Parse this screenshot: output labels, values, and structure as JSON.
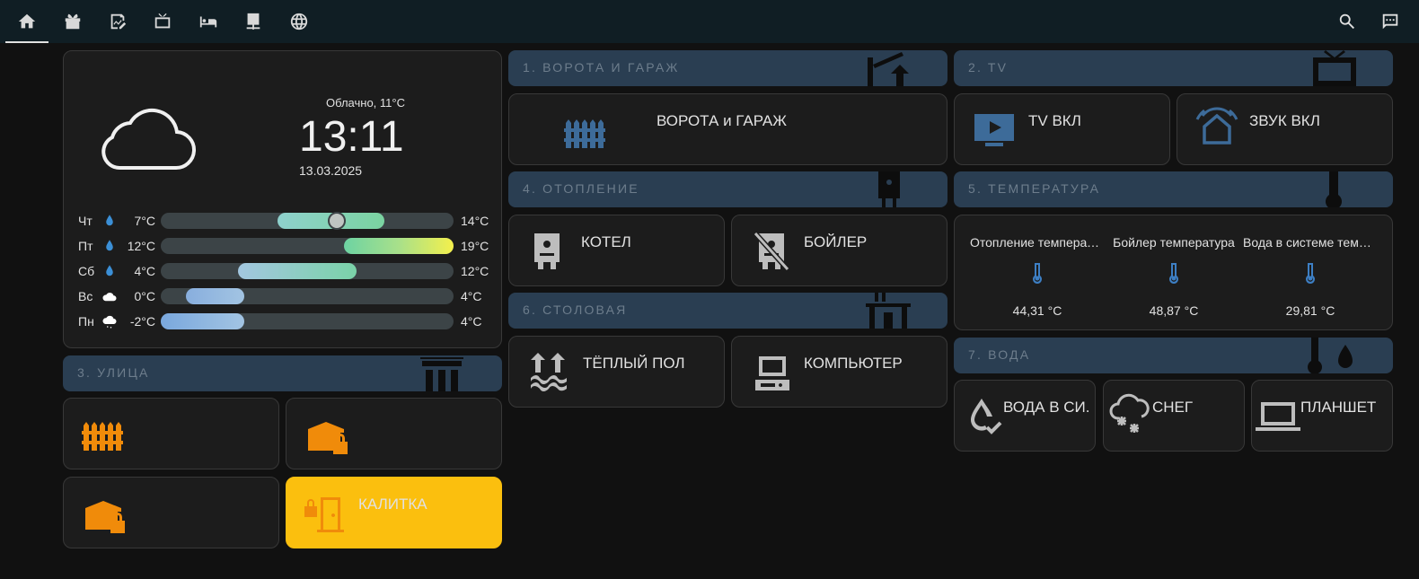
{
  "toolbar": {
    "tabs": [
      {
        "icon": "home-icon"
      },
      {
        "icon": "gift-icon"
      },
      {
        "icon": "chart-edit-icon"
      },
      {
        "icon": "tv-icon"
      },
      {
        "icon": "bed-icon"
      },
      {
        "icon": "server-icon"
      },
      {
        "icon": "globe-icon"
      }
    ],
    "search_icon": "search-icon",
    "assist_icon": "assist-icon"
  },
  "weather": {
    "condition": "Облачно, 11°C",
    "time": "13:11",
    "date": "13.03.2025",
    "forecast": [
      {
        "day": "Чт",
        "icon": "drop-icon",
        "low": "7°C",
        "high": "14°C"
      },
      {
        "day": "Пт",
        "icon": "drop-icon",
        "low": "12°C",
        "high": "19°C"
      },
      {
        "day": "Сб",
        "icon": "drop-icon",
        "low": "4°C",
        "high": "12°C"
      },
      {
        "day": "Вс",
        "icon": "cloud-icon",
        "low": "0°C",
        "high": "4°C"
      },
      {
        "day": "Пн",
        "icon": "snow-cloud-icon",
        "low": "-2°C",
        "high": "4°C"
      }
    ],
    "current_temp": 11
  },
  "sections": {
    "gates": {
      "title": "1. ВОРОТА И ГАРАЖ",
      "button": "ВОРОТА и ГАРАЖ"
    },
    "tv": {
      "title": "2. TV",
      "buttons": [
        "TV ВКЛ",
        "ЗВУК ВКЛ"
      ]
    },
    "street": {
      "title": "3. УЛИЦА",
      "gate_button": "КАЛИТКА"
    },
    "heating": {
      "title": "4. ОТОПЛЕНИЕ",
      "buttons": [
        "КОТЕЛ",
        "БОЙЛЕР"
      ]
    },
    "temperature": {
      "title": "5. ТЕМПЕРАТУРА",
      "sensors": [
        {
          "name": "Отопление температура",
          "value": "44,31 °C"
        },
        {
          "name": "Бойлер температура",
          "value": "48,87 °C"
        },
        {
          "name": "Вода в системе температура",
          "value": "29,81 °C"
        }
      ]
    },
    "dining": {
      "title": "6. СТОЛОВАЯ",
      "buttons": [
        "ТЁПЛЫЙ ПОЛ",
        "КОМПЬЮТЕР"
      ]
    },
    "water": {
      "title": "7. ВОДА",
      "buttons": [
        "ВОДА В СИ...",
        "СНЕГ",
        "ПЛАНШЕТ"
      ]
    }
  },
  "colors": {
    "accent": "#fbbf0e",
    "orange": "#f08b0a",
    "blue": "#3d6b99",
    "header": "#2a3e52",
    "card": "#1c1c1c"
  }
}
